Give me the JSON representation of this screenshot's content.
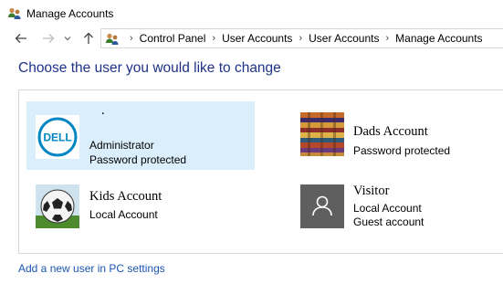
{
  "window": {
    "title": "Manage Accounts",
    "icon": "user-accounts-icon"
  },
  "nav": {
    "back_icon": "arrow-left-icon",
    "forward_icon": "arrow-right-icon",
    "recent_icon": "chevron-down-icon",
    "up_icon": "arrow-up-icon"
  },
  "breadcrumb": [
    "Control Panel",
    "User Accounts",
    "User Accounts",
    "Manage Accounts"
  ],
  "heading": "Choose the user you would like to change",
  "accounts": [
    {
      "name": ".",
      "lines": [
        "Administrator",
        "Password protected"
      ],
      "avatar": "dell-logo-icon",
      "selected": true
    },
    {
      "name": "Dads Account",
      "lines": [
        "Password protected"
      ],
      "avatar": "textile-pattern-icon",
      "selected": false
    },
    {
      "name": "Kids Account",
      "lines": [
        "Local Account"
      ],
      "avatar": "soccer-ball-icon",
      "selected": false
    },
    {
      "name": "Visitor",
      "lines": [
        "Local Account",
        "Guest account"
      ],
      "avatar": "generic-user-icon",
      "selected": false
    }
  ],
  "add_user_link": "Add a new user in PC settings",
  "colors": {
    "heading": "#1e3287",
    "link": "#1a55b5",
    "selected_bg": "#dbeefb",
    "dell_blue": "#0085c3",
    "guest_tile": "#5f5f5f"
  }
}
